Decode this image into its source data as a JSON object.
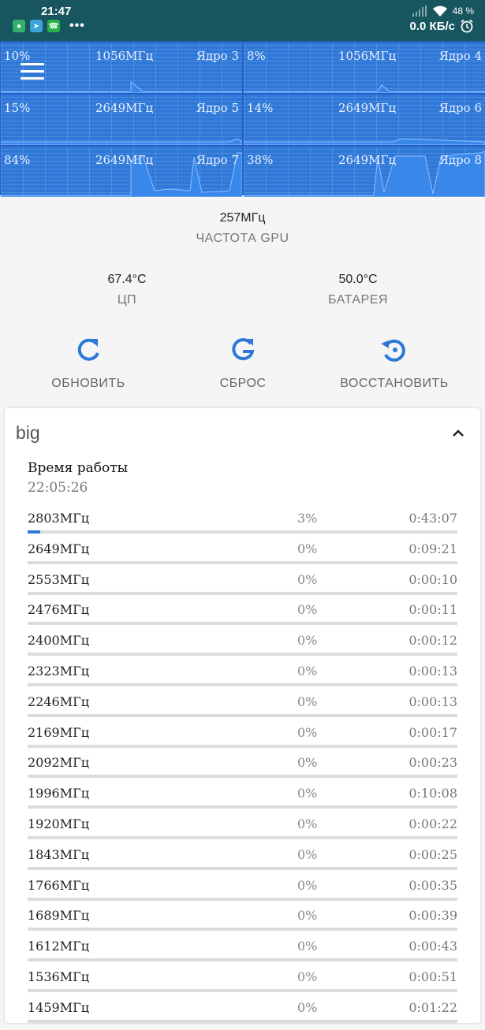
{
  "status_bar": {
    "time": "21:47",
    "battery": "48 %",
    "speed": "0.0 КБ/с",
    "app_icons": [
      "shield-app-icon",
      "telegram-icon",
      "whatsapp-icon"
    ],
    "more": "•••"
  },
  "cores": [
    {
      "pct": "10%",
      "freq": "1056МГц",
      "name": "Ядро 3",
      "level": 0.1
    },
    {
      "pct": "8%",
      "freq": "1056МГц",
      "name": "Ядро 4",
      "level": 0.08
    },
    {
      "pct": "15%",
      "freq": "2649МГц",
      "name": "Ядро 5",
      "level": 0.15
    },
    {
      "pct": "14%",
      "freq": "2649МГц",
      "name": "Ядро 6",
      "level": 0.14
    },
    {
      "pct": "84%",
      "freq": "2649МГц",
      "name": "Ядро 7",
      "level": 0.84
    },
    {
      "pct": "38%",
      "freq": "2649МГц",
      "name": "Ядро 8",
      "level": 0.38
    }
  ],
  "gpu": {
    "value": "257МГц",
    "label": "ЧАСТОТА GPU"
  },
  "cpu_temp": {
    "value": "67.4°C",
    "label": "ЦП"
  },
  "battery_temp": {
    "value": "50.0°C",
    "label": "БАТАРЕЯ"
  },
  "actions": {
    "refresh": "ОБНОВИТЬ",
    "reset": "СБРОС",
    "restore": "ВОССТАНОВИТЬ"
  },
  "card": {
    "title": "big",
    "uptime_label": "Время работы",
    "uptime_value": "22:05:26",
    "rows": [
      {
        "freq": "2803МГц",
        "pct": "3%",
        "time": "0:43:07",
        "fraction": 0.03
      },
      {
        "freq": "2649МГц",
        "pct": "0%",
        "time": "0:09:21",
        "fraction": 0
      },
      {
        "freq": "2553МГц",
        "pct": "0%",
        "time": "0:00:10",
        "fraction": 0
      },
      {
        "freq": "2476МГц",
        "pct": "0%",
        "time": "0:00:11",
        "fraction": 0
      },
      {
        "freq": "2400МГц",
        "pct": "0%",
        "time": "0:00:12",
        "fraction": 0
      },
      {
        "freq": "2323МГц",
        "pct": "0%",
        "time": "0:00:13",
        "fraction": 0
      },
      {
        "freq": "2246МГц",
        "pct": "0%",
        "time": "0:00:13",
        "fraction": 0
      },
      {
        "freq": "2169МГц",
        "pct": "0%",
        "time": "0:00:17",
        "fraction": 0
      },
      {
        "freq": "2092МГц",
        "pct": "0%",
        "time": "0:00:23",
        "fraction": 0
      },
      {
        "freq": "1996МГц",
        "pct": "0%",
        "time": "0:10:08",
        "fraction": 0
      },
      {
        "freq": "1920МГц",
        "pct": "0%",
        "time": "0:00:22",
        "fraction": 0
      },
      {
        "freq": "1843МГц",
        "pct": "0%",
        "time": "0:00:25",
        "fraction": 0
      },
      {
        "freq": "1766МГц",
        "pct": "0%",
        "time": "0:00:35",
        "fraction": 0
      },
      {
        "freq": "1689МГц",
        "pct": "0%",
        "time": "0:00:39",
        "fraction": 0
      },
      {
        "freq": "1612МГц",
        "pct": "0%",
        "time": "0:00:43",
        "fraction": 0
      },
      {
        "freq": "1536МГц",
        "pct": "0%",
        "time": "0:00:51",
        "fraction": 0
      },
      {
        "freq": "1459МГц",
        "pct": "0%",
        "time": "0:01:22",
        "fraction": 0
      }
    ]
  }
}
